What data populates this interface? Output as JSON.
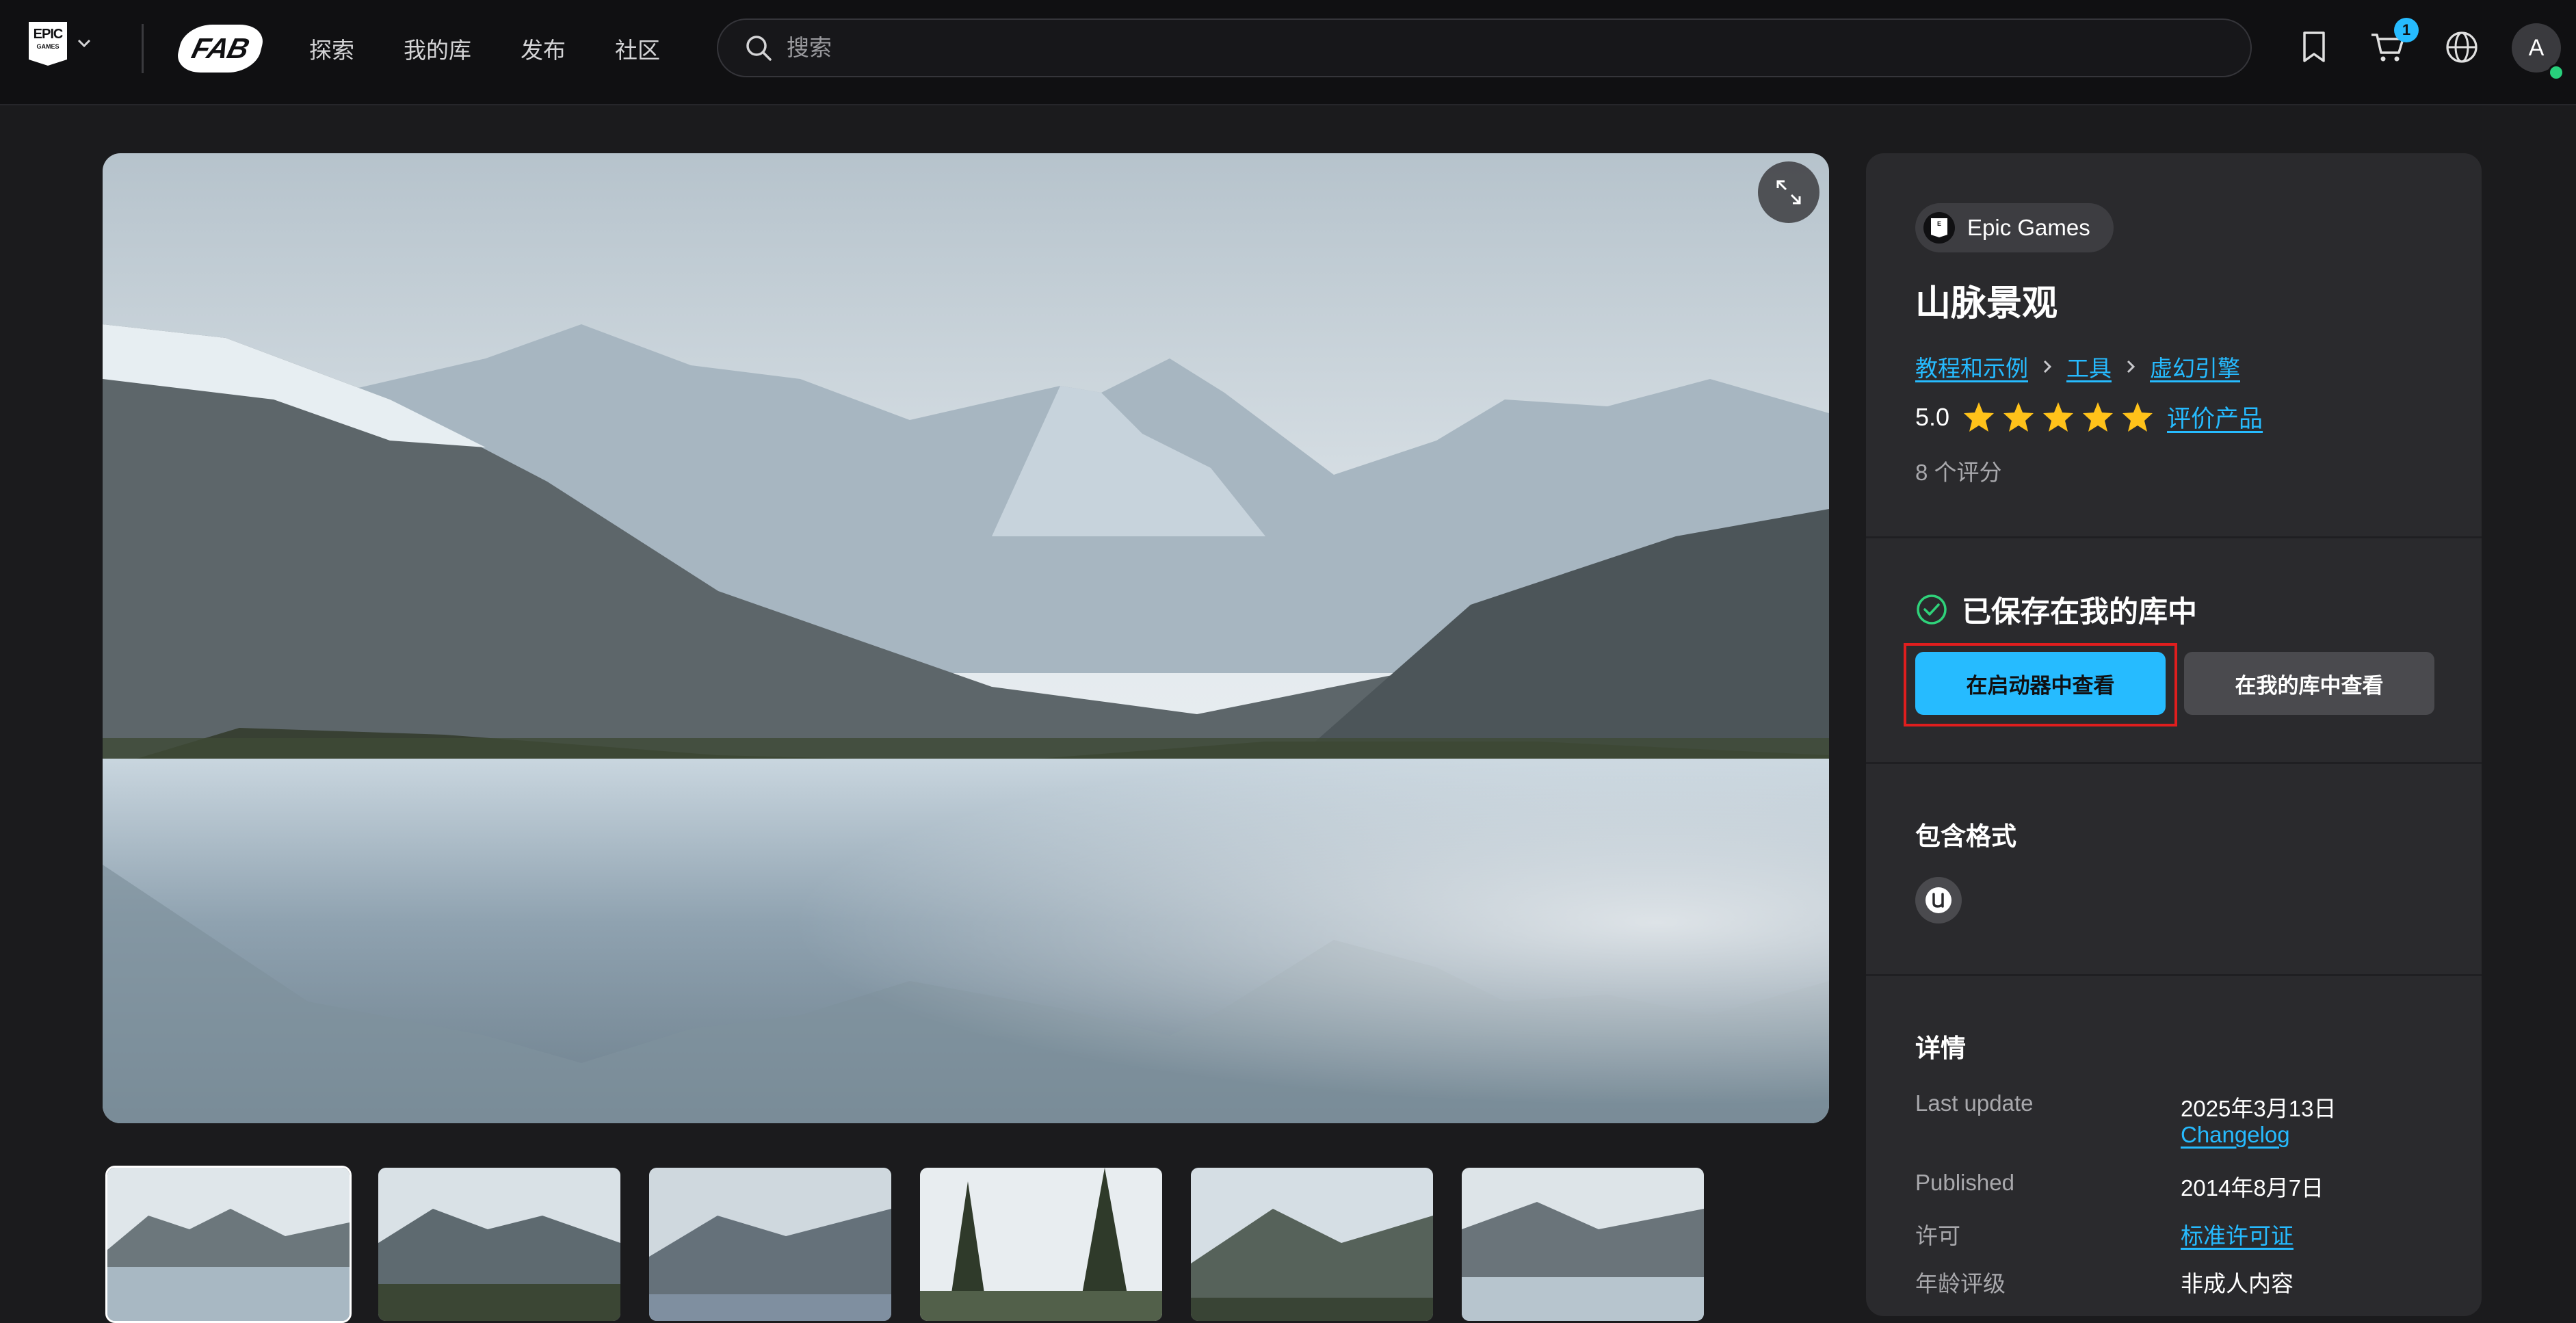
{
  "brand": {
    "epic_line1": "EPIC",
    "epic_line2": "GAMES",
    "fab": "FAB"
  },
  "nav": {
    "links": [
      "探索",
      "我的库",
      "发布",
      "社区"
    ]
  },
  "search": {
    "placeholder": "搜索"
  },
  "header": {
    "cart_count": "1",
    "avatar_initial": "A"
  },
  "product": {
    "publisher": "Epic Games",
    "title": "山脉景观",
    "breadcrumb": [
      "教程和示例",
      "工具",
      "虚幻引擎"
    ],
    "rating_value": "5.0",
    "stars": 5,
    "rate_link": "评价产品",
    "rating_count": "8 个评分"
  },
  "library": {
    "saved_text": "已保存在我的库中",
    "launcher_button": "在启动器中查看",
    "library_button": "在我的库中查看"
  },
  "formats": {
    "title": "包含格式",
    "icons": [
      "unreal-engine-icon"
    ]
  },
  "details": {
    "title": "详情",
    "last_update_label": "Last update",
    "last_update_value": "2025年3月13日",
    "changelog_link": "Changelog",
    "published_label": "Published",
    "published_value": "2014年8月7日",
    "license_label": "许可",
    "license_link": "标准许可证",
    "age_label": "年龄评级",
    "age_value": "非成人内容"
  },
  "gallery": {
    "thumbnail_count": 6,
    "active_index": 0
  },
  "colors": {
    "accent": "#26bbff",
    "panel": "#2a2a2d",
    "background": "#1b1b1d",
    "star": "#ffc21a",
    "saved_check": "#2fd27a",
    "highlight": "#e01e1e"
  }
}
